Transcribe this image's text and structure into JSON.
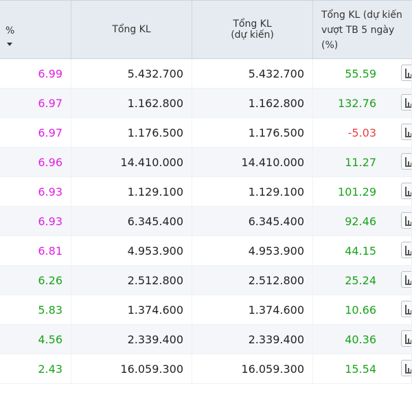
{
  "header": {
    "col1": "%",
    "col2": "Tổng KL",
    "col3_line1": "Tổng KL",
    "col3_line2": "(dự kiến)",
    "col4_line1": "Tổng KL (dự kiến",
    "col4_line2": "vượt TB 5 ngày",
    "col4_line3": "(%)"
  },
  "colors": {
    "pink": "#e11ee1",
    "green": "#18a318",
    "red": "#e84040",
    "header_bg": "#e6ebf1"
  },
  "rows": [
    {
      "pct": "6.99",
      "pct_color": "pink",
      "total": "5.432.700",
      "expected": "5.432.700",
      "over": "55.59",
      "over_color": "green"
    },
    {
      "pct": "6.97",
      "pct_color": "pink",
      "total": "1.162.800",
      "expected": "1.162.800",
      "over": "132.76",
      "over_color": "green"
    },
    {
      "pct": "6.97",
      "pct_color": "pink",
      "total": "1.176.500",
      "expected": "1.176.500",
      "over": "-5.03",
      "over_color": "red"
    },
    {
      "pct": "6.96",
      "pct_color": "pink",
      "total": "14.410.000",
      "expected": "14.410.000",
      "over": "11.27",
      "over_color": "green"
    },
    {
      "pct": "6.93",
      "pct_color": "pink",
      "total": "1.129.100",
      "expected": "1.129.100",
      "over": "101.29",
      "over_color": "green"
    },
    {
      "pct": "6.93",
      "pct_color": "pink",
      "total": "6.345.400",
      "expected": "6.345.400",
      "over": "92.46",
      "over_color": "green"
    },
    {
      "pct": "6.81",
      "pct_color": "pink",
      "total": "4.953.900",
      "expected": "4.953.900",
      "over": "44.15",
      "over_color": "green"
    },
    {
      "pct": "6.26",
      "pct_color": "green",
      "total": "2.512.800",
      "expected": "2.512.800",
      "over": "25.24",
      "over_color": "green"
    },
    {
      "pct": "5.83",
      "pct_color": "green",
      "total": "1.374.600",
      "expected": "1.374.600",
      "over": "10.66",
      "over_color": "green"
    },
    {
      "pct": "4.56",
      "pct_color": "green",
      "total": "2.339.400",
      "expected": "2.339.400",
      "over": "40.36",
      "over_color": "green"
    },
    {
      "pct": "2.43",
      "pct_color": "green",
      "total": "16.059.300",
      "expected": "16.059.300",
      "over": "15.54",
      "over_color": "green"
    }
  ],
  "row_icon": "bar-chart-icon"
}
